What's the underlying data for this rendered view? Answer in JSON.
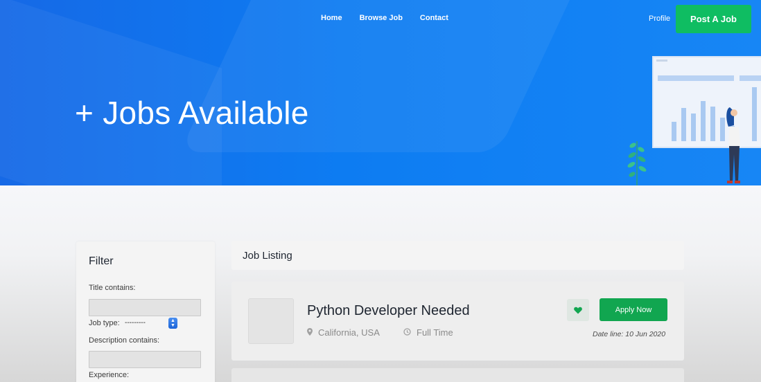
{
  "nav": {
    "links": [
      "Home",
      "Browse Job",
      "Contact"
    ],
    "profile_label": "Profile",
    "post_job_label": "Post A Job"
  },
  "hero": {
    "title": "+ Jobs Available"
  },
  "filter": {
    "title": "Filter",
    "title_contains_label": "Title contains:",
    "title_contains_value": "",
    "job_type_label": "Job type:",
    "job_type_value": "---------",
    "description_contains_label": "Description contains:",
    "description_contains_value": "",
    "experience_label": "Experience:"
  },
  "listing": {
    "header": "Job Listing",
    "jobs": [
      {
        "title": "Python Developer Needed",
        "location": "California, USA",
        "type": "Full Time",
        "apply_label": "Apply Now",
        "deadline": "Date line: 10 Jun 2020"
      }
    ]
  },
  "colors": {
    "hero_blue": "#0d7cf2",
    "accent_green": "#11a650",
    "post_button_green": "#0fbd62"
  }
}
